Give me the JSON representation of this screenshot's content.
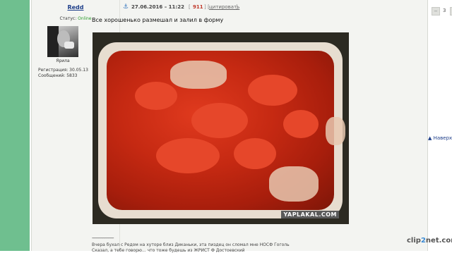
{
  "user": {
    "name": "Redd",
    "status_label": "Статус:",
    "status_value": "Online",
    "rank": "Ярила",
    "registration": "Регистрация: 30.05.13",
    "messages": "Сообщений: 5833"
  },
  "post": {
    "date": "27.06.2016 – 11:22",
    "number": "911",
    "quote_label": "цитировать",
    "rating": "3",
    "text": "Все хорошенько размешал и залил в форму",
    "image_watermark": "YAPLAKAL.COM",
    "signature_divider": "--------------------",
    "signature_line1": "Вчера бухал с Редом на хуторе близ Диканьки, эта пиздец он сломал мне НОСФ Гоголь",
    "signature_line2": "Сказал, а тебе говорю... что тоже будешь из ЖРИСТ Ф Достоевский"
  },
  "side": {
    "back_link": "Наверх",
    "logo_part1": "clip",
    "logo_part2": "2",
    "logo_part3": "net",
    "logo_part4": ".com"
  },
  "colors": {
    "accent": "#1f3f8a",
    "online": "#2a9a2a",
    "post_number": "#c0392b",
    "left_band": "#6fbf8f"
  }
}
